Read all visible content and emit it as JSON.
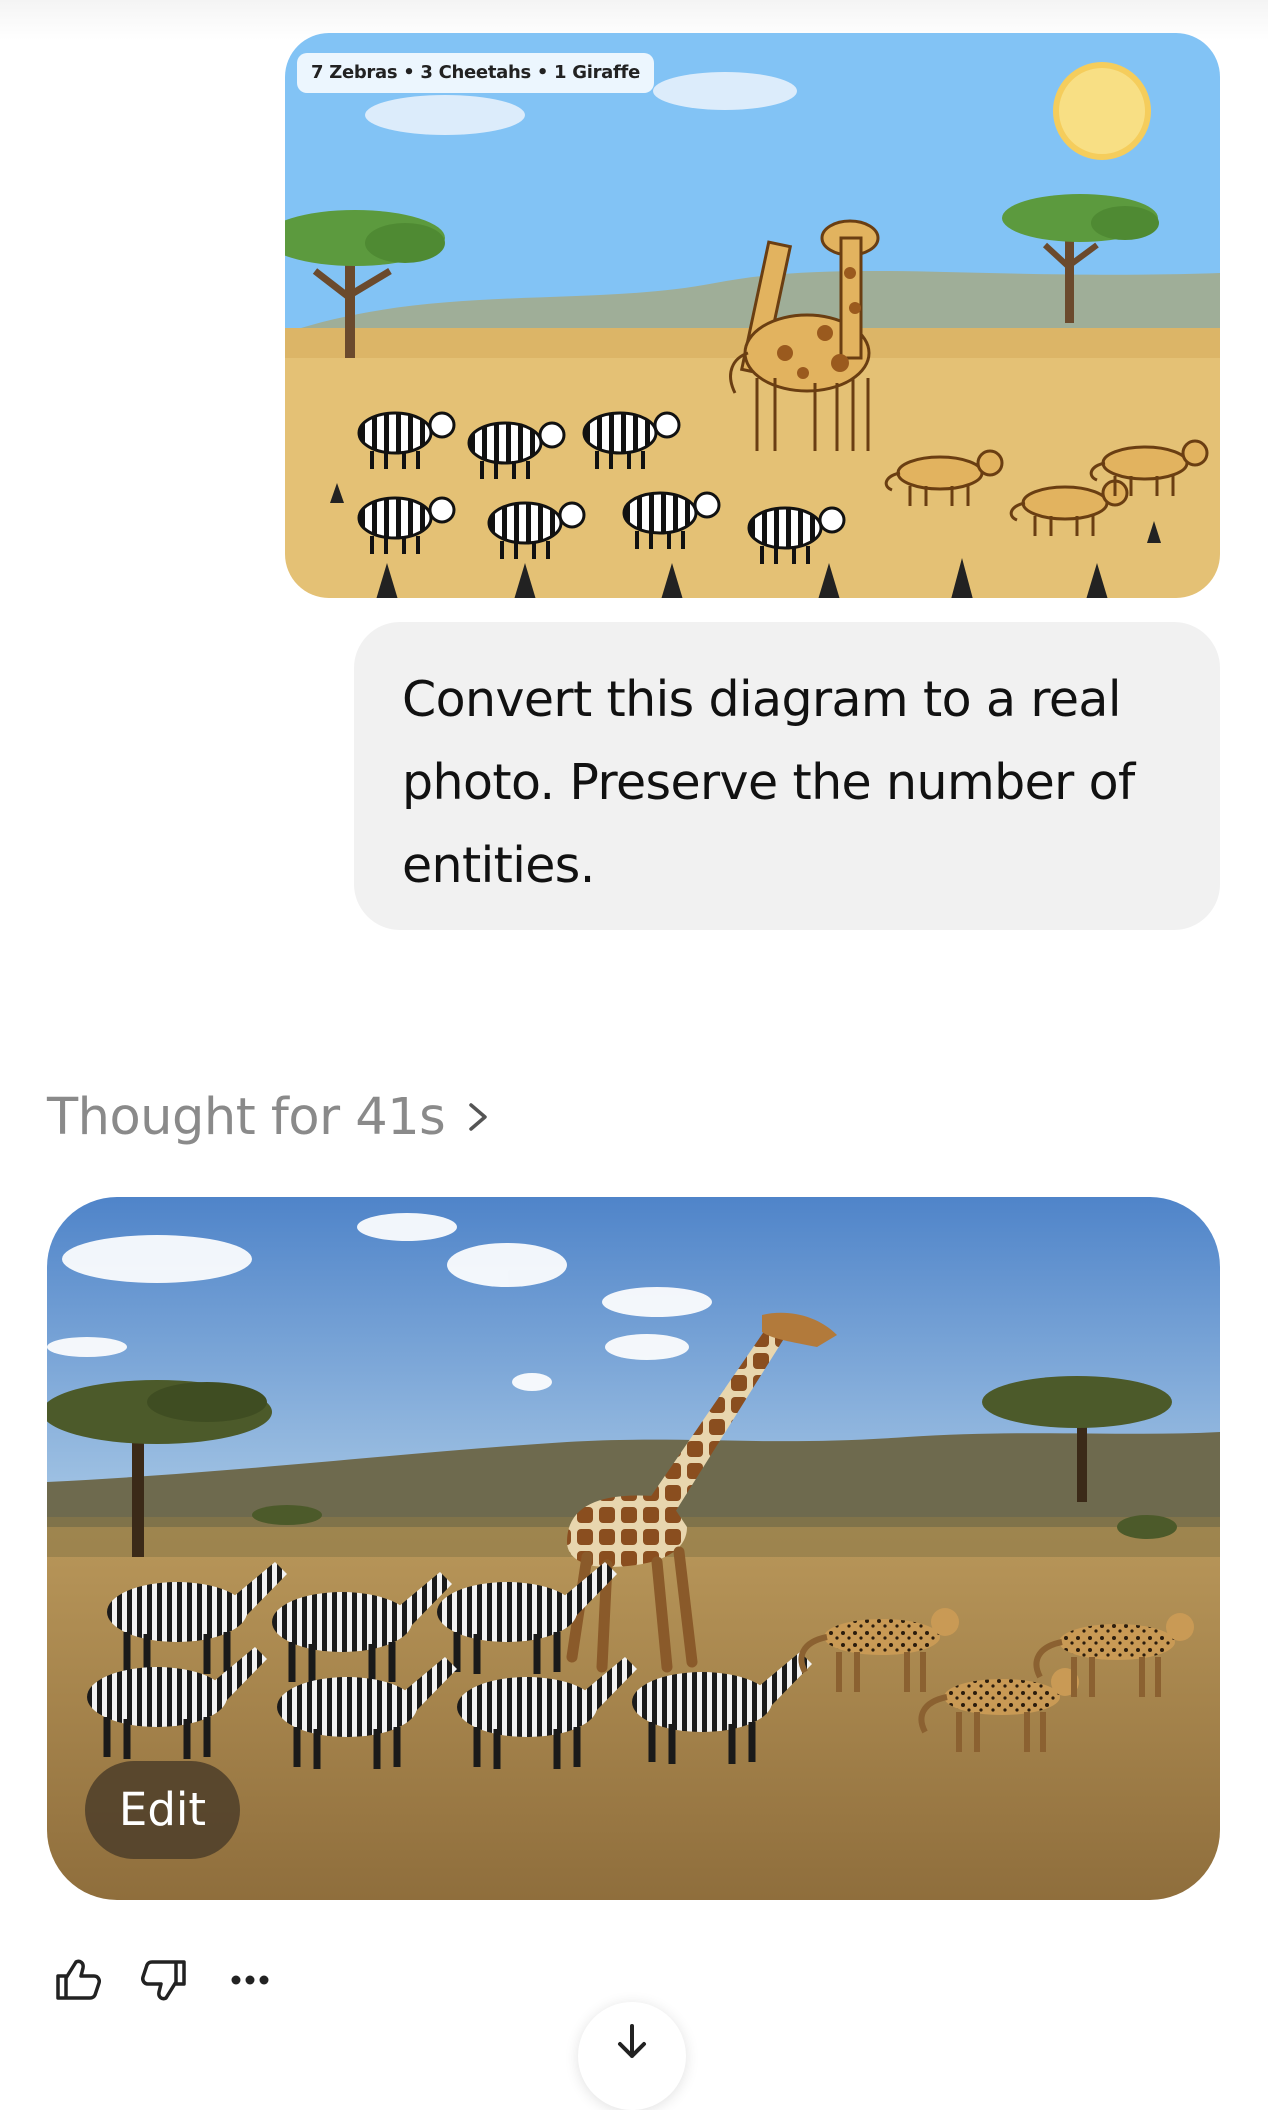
{
  "conversation": {
    "user_image": {
      "caption": "7 Zebras • 3 Cheetahs • 1 Giraffe",
      "zebra_count": 7,
      "cheetah_count": 3,
      "giraffe_count": 1
    },
    "user_message": "Convert this diagram to a real photo. Preserve the number of entities.",
    "thought_label": "Thought for 41s",
    "generated_image": {
      "edit_label": "Edit",
      "zebra_count": 7,
      "cheetah_count": 3,
      "giraffe_count": 1
    }
  },
  "actions": {
    "icons": [
      "thumbs-up-icon",
      "thumbs-down-icon",
      "more-icon"
    ]
  },
  "colors": {
    "bubble_bg": "#f1f1f1",
    "thought_text": "#8a8a8a",
    "diagram_sky": "#82c3f5",
    "diagram_ground": "#e4c175",
    "edit_button_bg": "#50402a"
  }
}
